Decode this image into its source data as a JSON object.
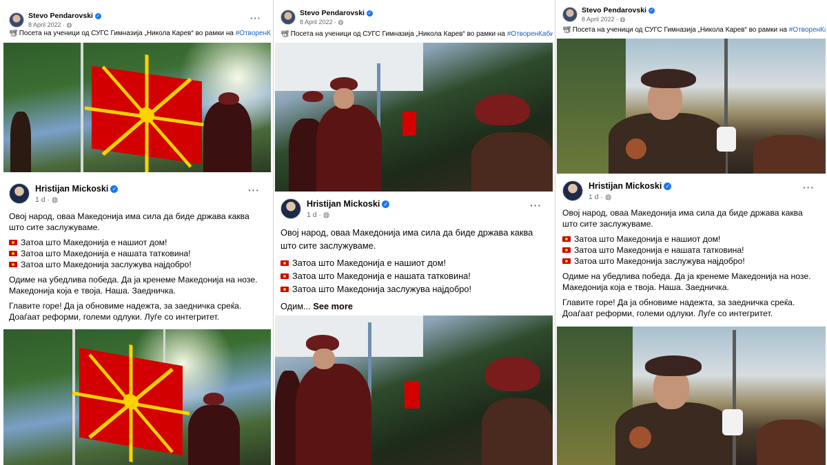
{
  "shared_post": {
    "author": "Stevo Pendarovski",
    "date": "8 April 2022",
    "privacy_icon": "globe-icon",
    "caption_prefix": "Посета на ученици од СУГС Гимназија „Никола Карев“ во рамки на",
    "hashtag": "#ОтворенКабинет",
    "more": "···"
  },
  "post": {
    "author": "Hristijan Mickoski",
    "time": "1 d",
    "more": "···",
    "intro": "Овој народ, оваа Македонија има сила да биде држава каква што сите заслужуваме.",
    "intro_line1": "Овој народ, оваа Македонија има сила да биде држава каква",
    "intro_line2": "што сите заслужуваме.",
    "reasons": [
      "Затоа што Македонија е нашиот дом!",
      "Затоа што Македонија е нашата татковина!",
      "Затоа што Македонија заслужува најдобро!"
    ],
    "para2_line1": "Одиме на убедлива победа. Да ја кренеме Македонија на нозе.",
    "para2_line2": "Македонија која е твоја. Наша. Заедничка.",
    "para3_line1": "Главите горе! Да ја обновиме надежта, за заедничка среќа.",
    "para3_line2": "Доаѓаат реформи, големи одлуки. Луѓе со интегритет.",
    "truncated": "Одим...",
    "see_more": "See more"
  },
  "colors": {
    "verified": "#1877f2",
    "hashtag": "#1a5fc4",
    "flag_red": "#d20000",
    "flag_yellow": "#ffd200",
    "meta_gray": "#65676b"
  }
}
